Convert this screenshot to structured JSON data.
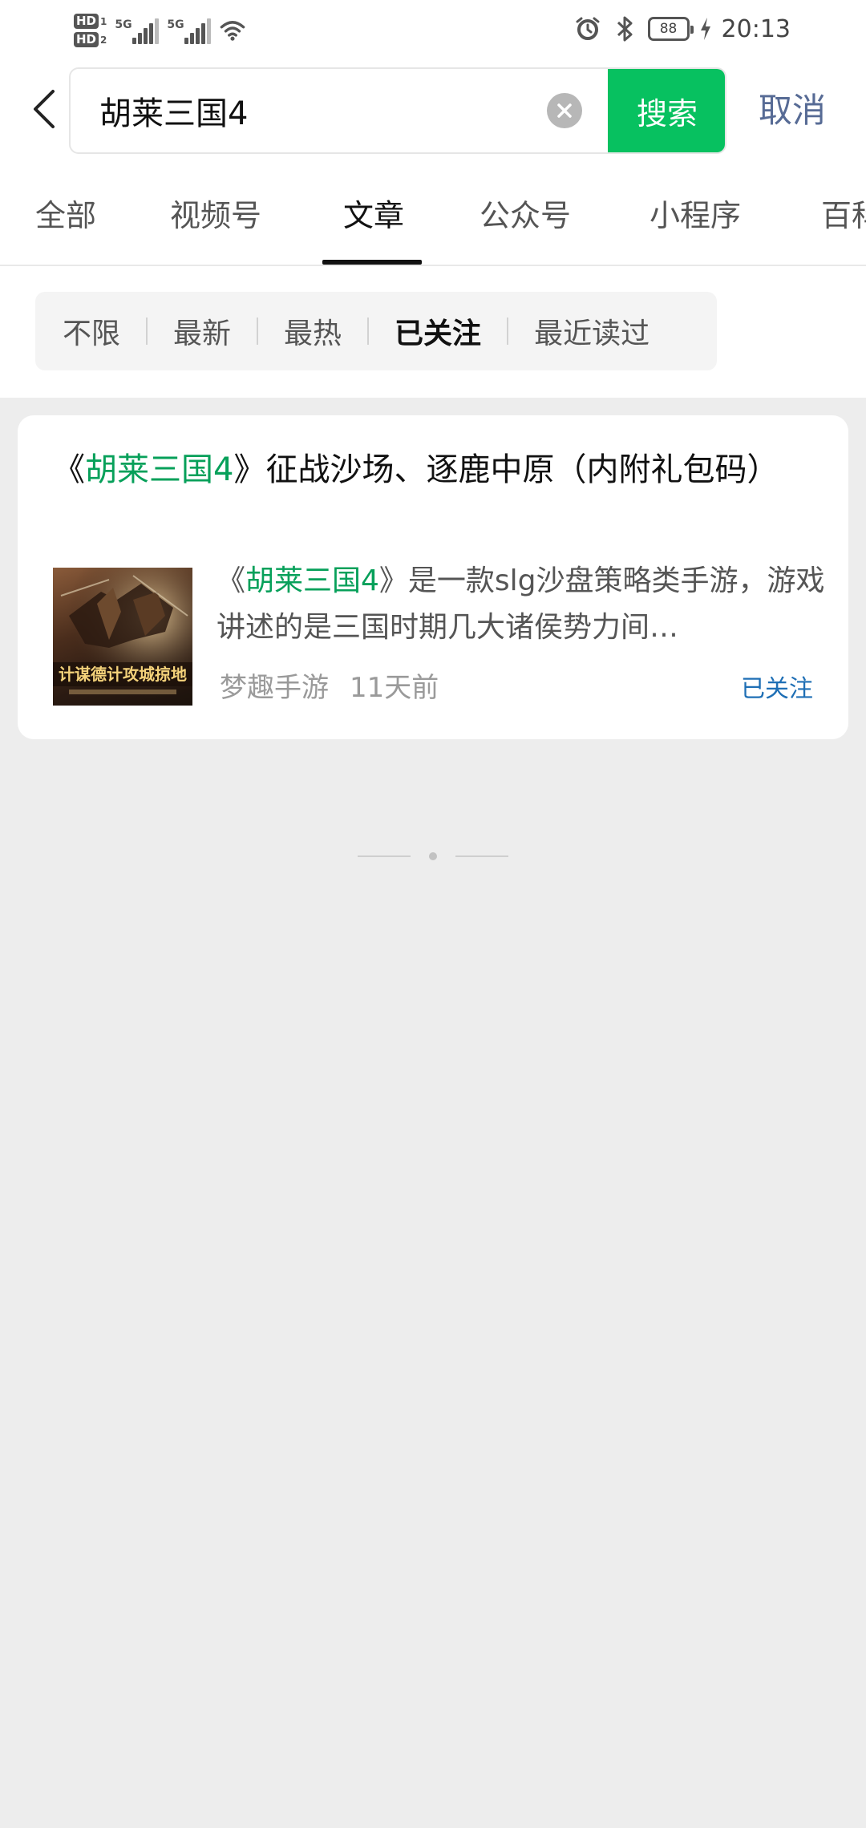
{
  "status_bar": {
    "sim1_label": "HD",
    "sim1_num": "1",
    "sim2_label": "HD",
    "sim2_num": "2",
    "network1": "5G",
    "network2": "5G",
    "battery": "88",
    "time": "20:13",
    "icons": [
      "wifi-icon",
      "alarm-icon",
      "bluetooth-icon",
      "charging-icon"
    ]
  },
  "search": {
    "query": "胡莱三国4",
    "button_label": "搜索",
    "cancel_label": "取消"
  },
  "tabs": [
    {
      "label": "全部"
    },
    {
      "label": "视频号"
    },
    {
      "label": "文章",
      "active": true
    },
    {
      "label": "公众号"
    },
    {
      "label": "小程序"
    },
    {
      "label": "百科"
    }
  ],
  "filters": [
    {
      "label": "不限"
    },
    {
      "label": "最新"
    },
    {
      "label": "最热"
    },
    {
      "label": "已关注",
      "active": true
    },
    {
      "label": "最近读过"
    }
  ],
  "result": {
    "title_prefix": "《",
    "title_highlight": "胡莱三国4",
    "title_suffix": "》征战沙场、逐鹿中原（内附礼包码）",
    "summary_prefix": "《",
    "summary_highlight": "胡莱三国4",
    "summary_suffix": "》是一款slg沙盘策略类手游，游戏讲述的是三国时期几大诸侯势力间…",
    "thumbnail_text": "计谋德计攻城掠地",
    "source": "梦趣手游",
    "time_ago": "11天前",
    "badge": "已关注"
  },
  "colors": {
    "accent_green": "#07c160",
    "highlight_green": "#07a05a",
    "link_blue": "#576b95",
    "badge_blue": "#1f6fb5",
    "background": "#ededed"
  }
}
